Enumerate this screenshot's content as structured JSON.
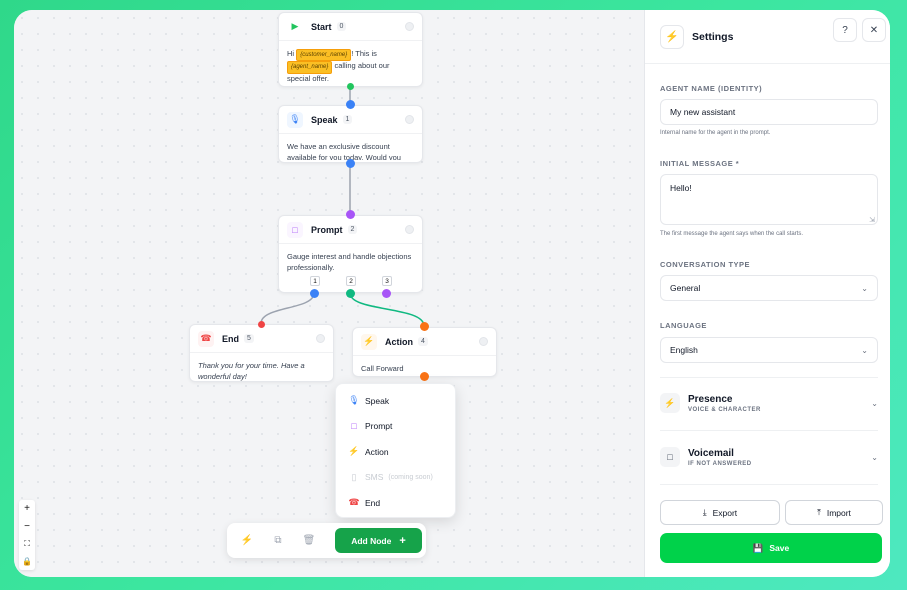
{
  "canvas": {
    "nodes": {
      "start": {
        "title": "Start",
        "num": "0",
        "text_before": "Hi",
        "tag1": "{customer_name}",
        "text_mid": "! This is",
        "tag2": "{agent_name}",
        "text_after": "calling about our special offer."
      },
      "speak": {
        "title": "Speak",
        "num": "1",
        "text": "We have an exclusive discount available for you today. Would you like to ..."
      },
      "prompt": {
        "title": "Prompt",
        "num": "2",
        "text": "Gauge interest and handle objections professionally.",
        "ports": [
          "1",
          "2",
          "3"
        ]
      },
      "end": {
        "title": "End",
        "num": "5",
        "text": "Thank you for your time. Have a wonderful day!"
      },
      "action": {
        "title": "Action",
        "num": "4",
        "text": "Call Forward"
      }
    },
    "menu": {
      "items": [
        "Speak",
        "Prompt",
        "Action",
        "SMS",
        "End"
      ],
      "coming_soon": "(coming soon)"
    },
    "toolbar": {
      "add_node_label": "Add Node"
    },
    "colors": {
      "start": "#22c55e",
      "speak": "#3b82f6",
      "prompt": "#a855f7",
      "action": "#f97316",
      "end": "#ef4444",
      "wire_green": "#10b981"
    }
  },
  "panel": {
    "title": "Settings",
    "agent_name": {
      "label": "AGENT NAME (IDENTITY)",
      "value": "My new assistant",
      "hint": "Internal name for the agent in the prompt."
    },
    "initial_message": {
      "label": "INITIAL MESSAGE *",
      "value": "Hello!",
      "hint": "The first message the agent says when the call starts."
    },
    "conversation_type": {
      "label": "CONVERSATION TYPE",
      "value": "General"
    },
    "language": {
      "label": "LANGUAGE",
      "value": "English"
    },
    "presence": {
      "title": "Presence",
      "subtitle": "VOICE & CHARACTER"
    },
    "voicemail": {
      "title": "Voicemail",
      "subtitle": "IF NOT ANSWERED"
    },
    "export_label": "Export",
    "import_label": "Import",
    "save_label": "Save"
  }
}
